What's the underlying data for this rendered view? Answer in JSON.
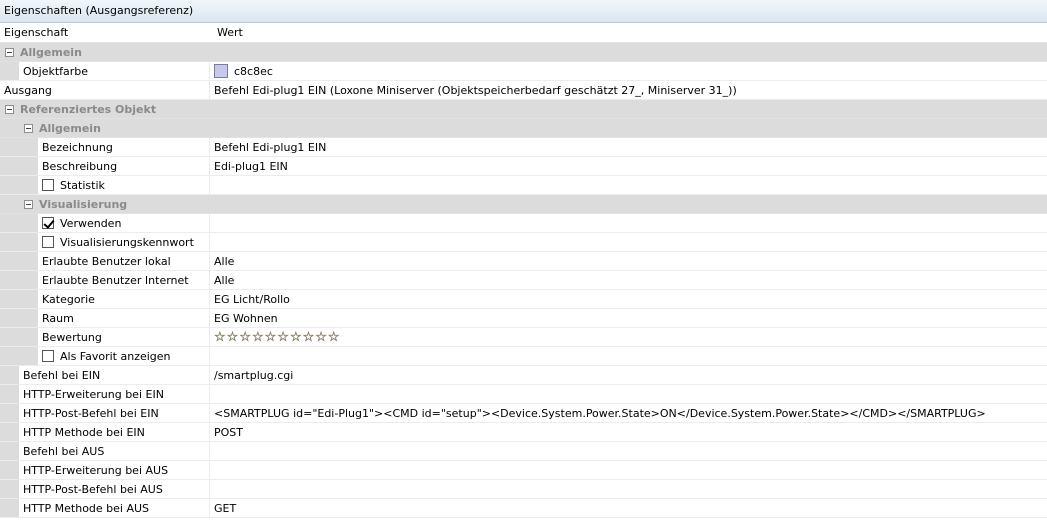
{
  "window": {
    "title": "Eigenschaften (Ausgangsreferenz)"
  },
  "header": {
    "col_property": "Eigenschaft",
    "col_value": "Wert"
  },
  "general": {
    "label": "Allgemein",
    "objektfarbe_label": "Objektfarbe",
    "objektfarbe_value": "c8c8ec",
    "objektfarbe_color": "#c8c8ec"
  },
  "ausgang": {
    "label": "Ausgang",
    "value": "Befehl Edi-plug1 EIN (Loxone Miniserver (Objektspeicherbedarf geschätzt 27_, Miniserver 31_))"
  },
  "ref": {
    "label": "Referenziertes Objekt",
    "allgemein_label": "Allgemein",
    "bezeichnung_label": "Bezeichnung",
    "bezeichnung_value": "Befehl Edi-plug1 EIN",
    "beschreibung_label": "Beschreibung",
    "beschreibung_value": "Edi-plug1 EIN",
    "statistik_label": "Statistik",
    "statistik_checked": false,
    "visualisierung_label": "Visualisierung",
    "verwenden_label": "Verwenden",
    "verwenden_checked": true,
    "viskennwort_label": "Visualisierungskennwort",
    "viskennwort_checked": false,
    "benutzer_lokal_label": "Erlaubte Benutzer lokal",
    "benutzer_lokal_value": "Alle",
    "benutzer_internet_label": "Erlaubte Benutzer Internet",
    "benutzer_internet_value": "Alle",
    "kategorie_label": "Kategorie",
    "kategorie_value": "EG Licht/Rollo",
    "raum_label": "Raum",
    "raum_value": "EG Wohnen",
    "bewertung_label": "Bewertung",
    "bewertung_stars_total": 10,
    "bewertung_stars_filled": 0,
    "favorit_label": "Als Favorit anzeigen",
    "favorit_checked": false
  },
  "http": {
    "befehl_ein_label": "Befehl bei EIN",
    "befehl_ein_value": "/smartplug.cgi",
    "erweiterung_ein_label": "HTTP-Erweiterung bei EIN",
    "erweiterung_ein_value": "",
    "post_ein_label": "HTTP-Post-Befehl bei EIN",
    "post_ein_value": "<SMARTPLUG id=\"Edi-Plug1\"><CMD id=\"setup\"><Device.System.Power.State>ON</Device.System.Power.State></CMD></SMARTPLUG>",
    "methode_ein_label": "HTTP Methode bei EIN",
    "methode_ein_value": "POST",
    "befehl_aus_label": "Befehl bei AUS",
    "befehl_aus_value": "",
    "erweiterung_aus_label": "HTTP-Erweiterung bei AUS",
    "erweiterung_aus_value": "",
    "post_aus_label": "HTTP-Post-Befehl bei AUS",
    "post_aus_value": "",
    "methode_aus_label": "HTTP Methode bei AUS",
    "methode_aus_value": "GET"
  }
}
